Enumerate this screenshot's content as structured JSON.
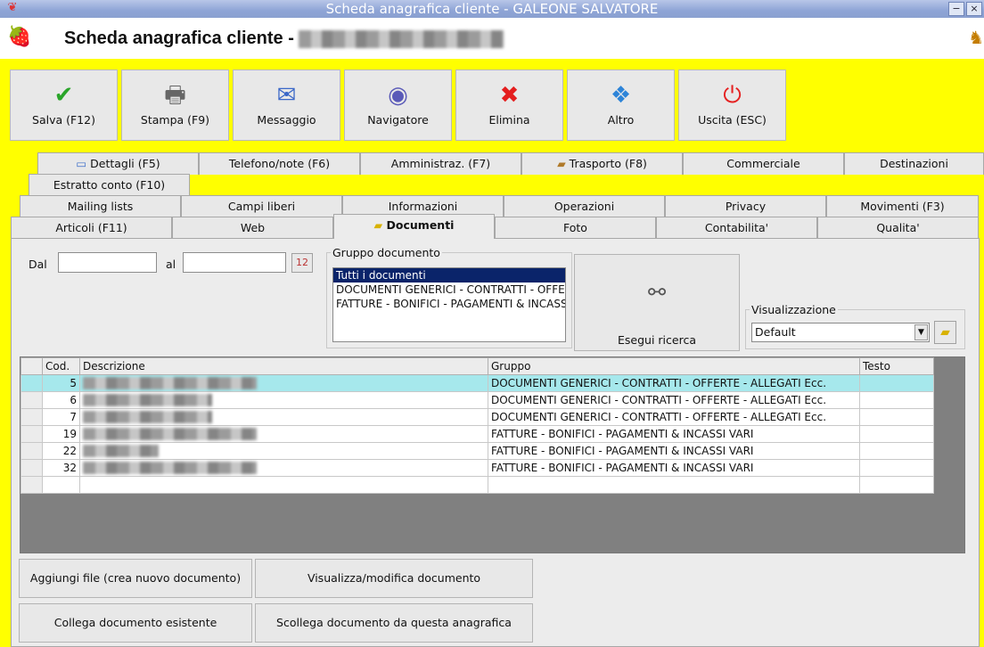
{
  "window": {
    "title": "Scheda anagrafica cliente - GALEONE SALVATORE",
    "minimize": "−",
    "close": "×"
  },
  "header": {
    "title": "Scheda anagrafica cliente - "
  },
  "toolbar": [
    {
      "label": "Salva (F12)",
      "icon": "✔"
    },
    {
      "label": "Stampa (F9)",
      "icon": "🖶"
    },
    {
      "label": "Messaggio",
      "icon": "✉"
    },
    {
      "label": "Navigatore",
      "icon": "◉"
    },
    {
      "label": "Elimina",
      "icon": "✖"
    },
    {
      "label": "Altro",
      "icon": "❖"
    },
    {
      "label": "Uscita (ESC)",
      "icon": "⏻"
    }
  ],
  "tabs": {
    "row1": [
      "Dettagli (F5)",
      "Telefono/note (F6)",
      "Amministraz. (F7)",
      "Trasporto (F8)",
      "Commerciale",
      "Destinazioni"
    ],
    "row2": [
      "Estratto conto (F10)"
    ],
    "row3": [
      "Mailing lists",
      "Campi liberi",
      "Informazioni",
      "Operazioni",
      "Privacy",
      "Movimenti (F3)"
    ],
    "row4": [
      "Articoli (F11)",
      "Web",
      "Documenti",
      "Foto",
      "Contabilita'",
      "Qualita'"
    ]
  },
  "filters": {
    "dal_label": "Dal",
    "al_label": "al",
    "dal_value": "",
    "al_value": "",
    "calendar_icon": "12"
  },
  "gruppo": {
    "legend": "Gruppo documento",
    "options": [
      "Tutti i documenti",
      "DOCUMENTI GENERICI - CONTRATTI - OFFERTE - ALLEGATI Ecc.",
      "FATTURE - BONIFICI - PAGAMENTI & INCASSI VARI"
    ],
    "selected": "Tutti i documenti"
  },
  "search": {
    "label": "Esegui ricerca"
  },
  "visualizzazione": {
    "legend": "Visualizzazione",
    "value": "Default"
  },
  "grid": {
    "columns": [
      "Cod.",
      "Descrizione",
      "Gruppo",
      "Testo"
    ],
    "rows": [
      {
        "cod": "5",
        "gruppo": "DOCUMENTI GENERICI - CONTRATTI - OFFERTE - ALLEGATI Ecc."
      },
      {
        "cod": "6",
        "gruppo": "DOCUMENTI GENERICI - CONTRATTI - OFFERTE - ALLEGATI Ecc."
      },
      {
        "cod": "7",
        "gruppo": "DOCUMENTI GENERICI - CONTRATTI - OFFERTE - ALLEGATI Ecc."
      },
      {
        "cod": "19",
        "gruppo": "FATTURE - BONIFICI - PAGAMENTI & INCASSI VARI"
      },
      {
        "cod": "22",
        "gruppo": "FATTURE - BONIFICI - PAGAMENTI & INCASSI VARI"
      },
      {
        "cod": "32",
        "gruppo": "FATTURE - BONIFICI - PAGAMENTI & INCASSI VARI"
      }
    ]
  },
  "buttons": {
    "add_file": "Aggiungi file (crea nuovo documento)",
    "view_edit": "Visualizza/modifica documento",
    "link_existing": "Collega documento esistente",
    "unlink": "Scollega documento da questa anagrafica"
  }
}
